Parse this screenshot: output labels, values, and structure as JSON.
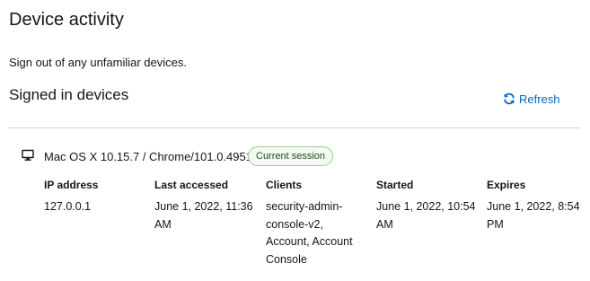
{
  "page": {
    "title": "Device activity",
    "intro": "Sign out of any unfamiliar devices."
  },
  "signed_in": {
    "title": "Signed in devices",
    "refresh_label": "Refresh",
    "refresh_icon": "refresh-icon"
  },
  "device": {
    "icon": "desktop-icon",
    "name": "Mac OS X 10.15.7 / Chrome/101.0.4951",
    "session_badge": "Current session",
    "columns": {
      "ip": {
        "header": "IP address",
        "value": "127.0.0.1"
      },
      "last_accessed": {
        "header": "Last accessed",
        "value": "June 1, 2022, 11:36 AM"
      },
      "clients": {
        "header": "Clients",
        "value": "security-admin-console-v2, Account, Account Console"
      },
      "started": {
        "header": "Started",
        "value": "June 1, 2022, 10:54 AM"
      },
      "expires": {
        "header": "Expires",
        "value": "June 1, 2022, 8:54 PM"
      }
    }
  },
  "colors": {
    "text": "#151515",
    "link": "#0066cc",
    "divider": "#d2d2d2",
    "badge_border": "#95d58e",
    "badge_bg": "#f3faf2",
    "badge_text": "#1e4f18"
  }
}
